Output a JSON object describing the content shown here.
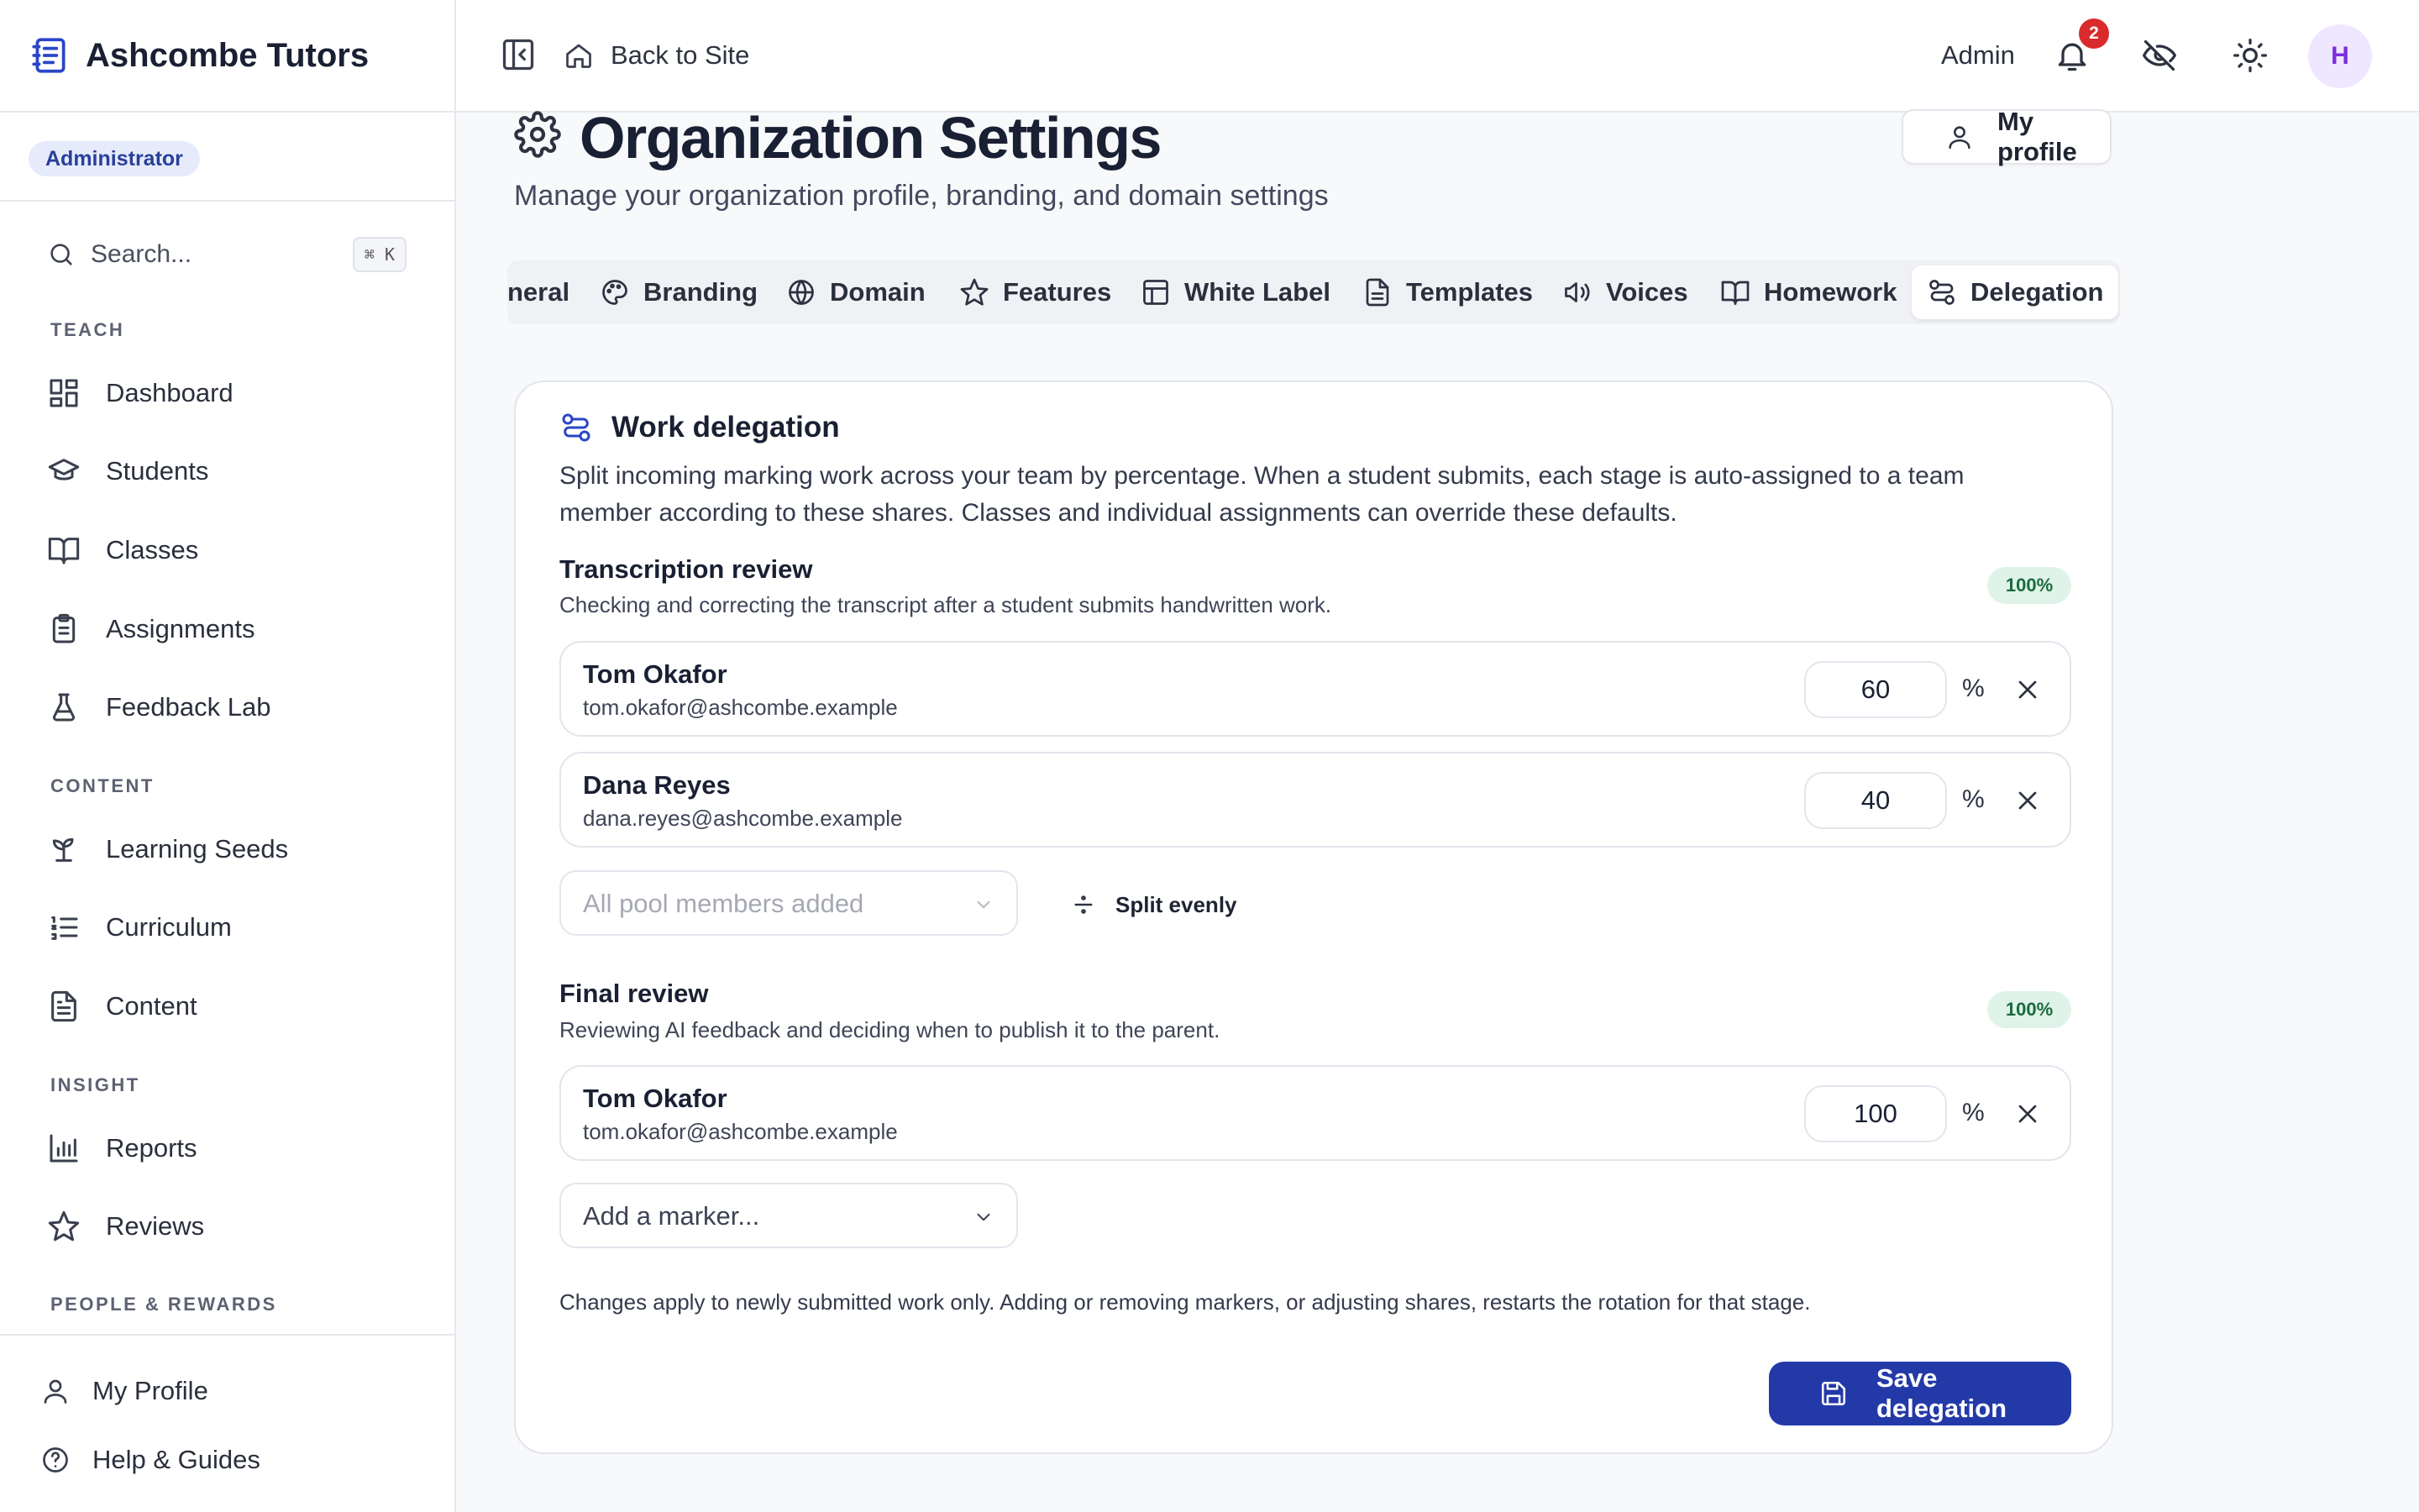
{
  "brand": {
    "name": "Ashcombe Tutors"
  },
  "role_badge": "Administrator",
  "search": {
    "label": "Search...",
    "shortcut": "⌘ K"
  },
  "sidebar": {
    "sections": [
      "TEACH",
      "CONTENT",
      "INSIGHT",
      "PEOPLE & REWARDS"
    ],
    "items": [
      {
        "label": "Dashboard",
        "icon": "dashboard-icon"
      },
      {
        "label": "Students",
        "icon": "graduation-cap-icon"
      },
      {
        "label": "Classes",
        "icon": "book-open-icon"
      },
      {
        "label": "Assignments",
        "icon": "clipboard-list-icon"
      },
      {
        "label": "Feedback Lab",
        "icon": "flask-icon"
      },
      {
        "label": "Learning Seeds",
        "icon": "sprout-icon"
      },
      {
        "label": "Curriculum",
        "icon": "list-ordered-icon"
      },
      {
        "label": "Content",
        "icon": "file-text-icon"
      },
      {
        "label": "Reports",
        "icon": "bar-chart-icon"
      },
      {
        "label": "Reviews",
        "icon": "star-icon"
      }
    ],
    "bottom": [
      {
        "label": "My Profile",
        "icon": "user-icon"
      },
      {
        "label": "Help & Guides",
        "icon": "help-circle-icon"
      }
    ]
  },
  "topbar": {
    "back_label": "Back to Site",
    "admin_label": "Admin",
    "notification_count": "2",
    "avatar_initial": "H"
  },
  "page": {
    "title": "Organization Settings",
    "subtitle": "Manage your organization profile, branding, and domain settings",
    "profile_button": "My profile"
  },
  "tabs": [
    {
      "label": "neral"
    },
    {
      "label": "Branding",
      "icon": "palette-icon"
    },
    {
      "label": "Domain",
      "icon": "globe-icon"
    },
    {
      "label": "Features",
      "icon": "star-icon"
    },
    {
      "label": "White Label",
      "icon": "layout-icon"
    },
    {
      "label": "Templates",
      "icon": "file-text-icon"
    },
    {
      "label": "Voices",
      "icon": "volume-icon"
    },
    {
      "label": "Homework",
      "icon": "book-open-icon"
    },
    {
      "label": "Delegation",
      "icon": "route-icon",
      "active": true
    }
  ],
  "card": {
    "title": "Work delegation",
    "description": "Split incoming marking work across your team by percentage. When a student submits, each stage is auto-assigned to a team member according to these shares. Classes and individual assignments can override these defaults.",
    "stages": [
      {
        "title": "Transcription review",
        "description": "Checking and correcting the transcript after a student submits handwritten work.",
        "total_badge": "100%",
        "members": [
          {
            "name": "Tom Okafor",
            "email": "tom.okafor@ashcombe.example",
            "share": "60"
          },
          {
            "name": "Dana Reyes",
            "email": "dana.reyes@ashcombe.example",
            "share": "40"
          }
        ],
        "select_label": "All pool members added",
        "split_label": "Split evenly"
      },
      {
        "title": "Final review",
        "description": "Reviewing AI feedback and deciding when to publish it to the parent.",
        "total_badge": "100%",
        "members": [
          {
            "name": "Tom Okafor",
            "email": "tom.okafor@ashcombe.example",
            "share": "100"
          }
        ],
        "select_label": "Add a marker..."
      }
    ],
    "percent_sign": "%",
    "note": "Changes apply to newly submitted work only. Adding or removing markers, or adjusting shares, restarts the rotation for that stage.",
    "save_label": "Save delegation"
  },
  "colors": {
    "accent": "#2439a8",
    "badge_green_bg": "#dff3e8",
    "notification_red": "#d92b2b",
    "avatar_purple": "#7b2ee0"
  }
}
